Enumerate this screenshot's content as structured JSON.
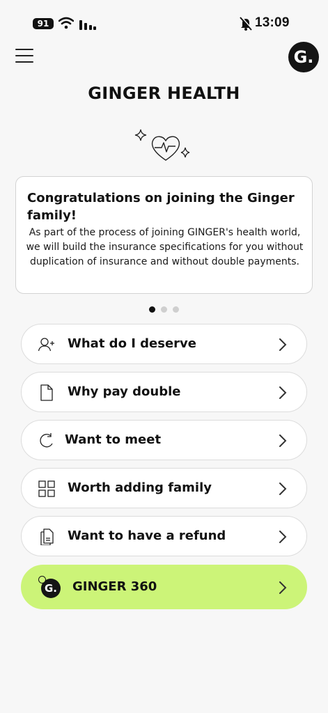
{
  "status_bar": {
    "battery": "91",
    "time": "13:09",
    "icons": [
      "battery-icon",
      "wifi-icon",
      "signal-icon",
      "bell-muted-icon"
    ]
  },
  "header": {
    "menu_icon": "hamburger-icon",
    "profile_logo_letter": "G.",
    "title": "GINGER HEALTH"
  },
  "card": {
    "heading": "Congratulations on joining the Ginger family!",
    "body": "As part of the process of joining GINGER's health world, we will build the insurance specifications for you without duplication of insurance and without double payments."
  },
  "pager": {
    "count": 3,
    "active_index": 0
  },
  "menu": [
    {
      "label": "What do I deserve",
      "icon": "user-plus-icon"
    },
    {
      "label": "Why pay double",
      "icon": "document-icon"
    },
    {
      "label": "Want to meet",
      "icon": "refresh-icon"
    },
    {
      "label": "Worth adding family",
      "icon": "grid-icon"
    },
    {
      "label": "Want to have a refund",
      "icon": "receipt-icon"
    },
    {
      "label": "GINGER 360",
      "icon": "ginger-logo-icon"
    }
  ],
  "colors": {
    "accent": "#ccf478",
    "background": "#f7f7f7",
    "dark": "#151515"
  }
}
